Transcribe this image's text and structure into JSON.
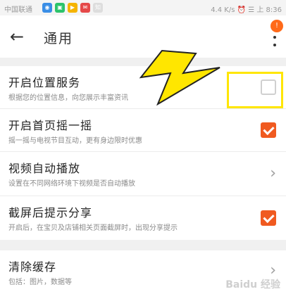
{
  "status": {
    "carrier": "中国联通",
    "right": "4.4 K/s ⏰ ☰ 上 8:36"
  },
  "header": {
    "title": "通用",
    "badge": "!"
  },
  "settings": [
    {
      "title": "开启位置服务",
      "subtitle": "根据您的位置信息，向您展示丰富资讯",
      "control": "checkbox",
      "checked": false
    },
    {
      "title": "开启首页摇一摇",
      "subtitle": "摇一摇与电视节目互动，更有身边限时优惠",
      "control": "checkbox",
      "checked": true
    },
    {
      "title": "视频自动播放",
      "subtitle": "设置在不同网络环境下视频是否自动播放",
      "control": "chevron"
    },
    {
      "title": "截屏后提示分享",
      "subtitle": "开启后，在宝贝及店铺相关页面截屏时，出现分享提示",
      "control": "checkbox",
      "checked": true
    }
  ],
  "cache": {
    "title": "清除缓存",
    "subtitle": "包括：图片，数据等"
  },
  "colors": {
    "accent": "#f05a20",
    "highlight": "#ffe600"
  },
  "watermark": "Baidu 经验"
}
